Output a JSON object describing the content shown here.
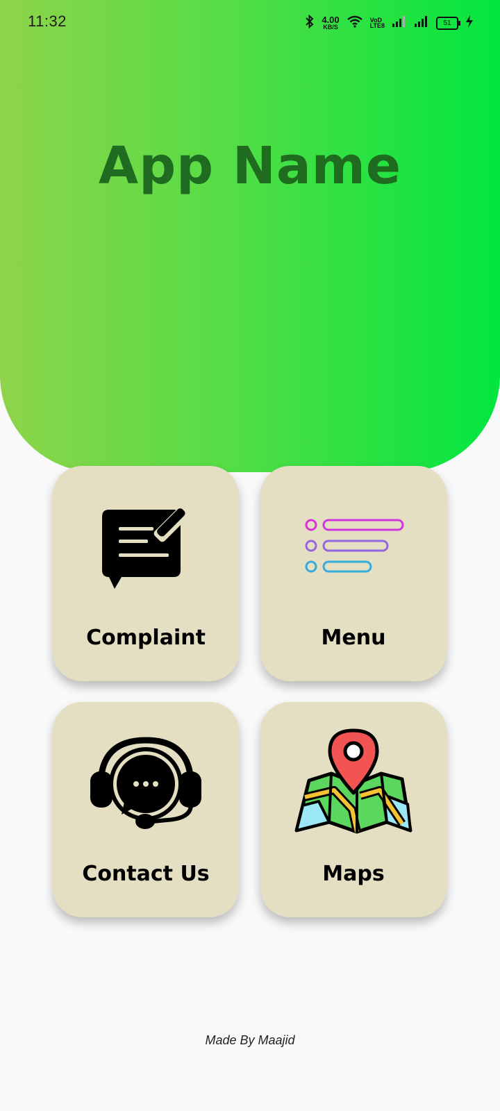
{
  "status_bar": {
    "time": "11:32",
    "network_speed": "4.00",
    "network_speed_unit": "KB/S",
    "volte_top": "VoD",
    "volte_bottom": "LTE8",
    "battery_level": "51",
    "icons": [
      "bluetooth-icon",
      "wifi-icon",
      "signal-icon",
      "signal-icon",
      "battery-icon",
      "charging-icon"
    ]
  },
  "header": {
    "title": "App Name",
    "gradient_colors": [
      "#8ed44a",
      "#02e63f"
    ],
    "title_color": "#1f6b20"
  },
  "grid": {
    "card_color": "#e4dfc2",
    "cards": [
      {
        "label": "Complaint",
        "icon": "complaint-icon"
      },
      {
        "label": "Menu",
        "icon": "menu-list-icon"
      },
      {
        "label": "Contact Us",
        "icon": "headset-support-icon"
      },
      {
        "label": "Maps",
        "icon": "map-pin-icon"
      }
    ]
  },
  "footer": {
    "text": "Made By Maajid"
  }
}
